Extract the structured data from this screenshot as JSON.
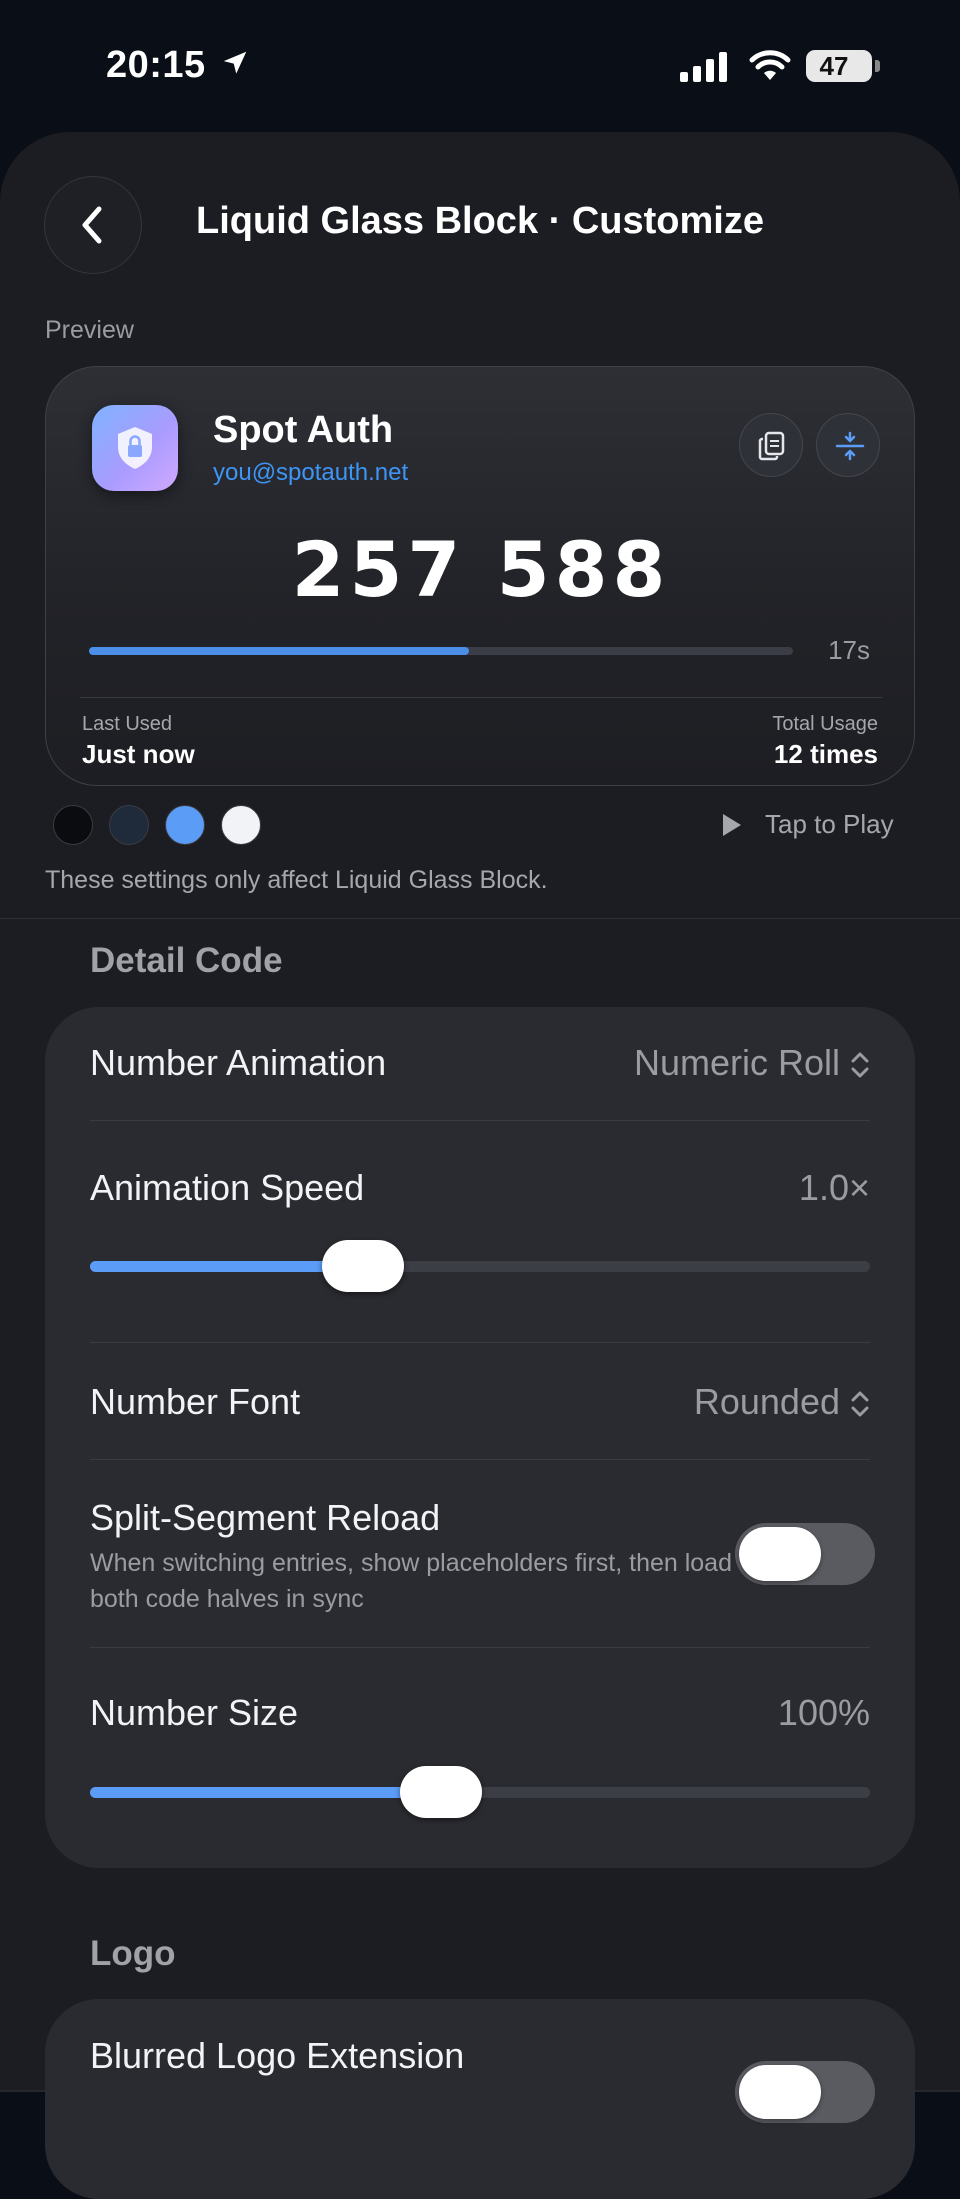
{
  "status_bar": {
    "time": "20:15",
    "battery": "47"
  },
  "nav": {
    "title": "Liquid Glass Block · Customize"
  },
  "preview": {
    "label": "Preview",
    "app_name": "Spot Auth",
    "account": "you@spotauth.net",
    "code": "257 588",
    "seconds_left": "17s",
    "progress_fraction": 0.54,
    "last_used_label": "Last Used",
    "last_used_value": "Just now",
    "total_usage_label": "Total Usage",
    "total_usage_value": "12 times",
    "swatches": [
      "#0b0c0f",
      "#1f2a3a",
      "#5b9cf6",
      "#f1f3f6"
    ],
    "tap_to_play": "Tap to Play",
    "note": "These settings only affect Liquid Glass Block."
  },
  "detail_code": {
    "header": "Detail Code",
    "number_animation": {
      "label": "Number Animation",
      "value": "Numeric Roll"
    },
    "animation_speed": {
      "label": "Animation Speed",
      "value": "1.0×",
      "fraction": 0.35
    },
    "number_font": {
      "label": "Number Font",
      "value": "Rounded"
    },
    "split_segment": {
      "label": "Split-Segment Reload",
      "description": "When switching entries, show placeholders first, then load both code halves in sync",
      "enabled": false
    },
    "number_size": {
      "label": "Number Size",
      "value": "100%",
      "fraction": 0.45
    }
  },
  "logo": {
    "header": "Logo",
    "blurred_logo_extension": {
      "label": "Blurred Logo Extension",
      "enabled": false
    }
  },
  "colors": {
    "accent": "#5b9cf6",
    "email": "#3d95f5"
  },
  "icons": [
    "location-arrow-icon",
    "cellular-signal-icon",
    "wifi-icon",
    "battery-icon",
    "chevron-left-icon",
    "shield-lock-icon",
    "copy-icon",
    "split-icon",
    "play-icon",
    "chevron-up-down-icon"
  ]
}
